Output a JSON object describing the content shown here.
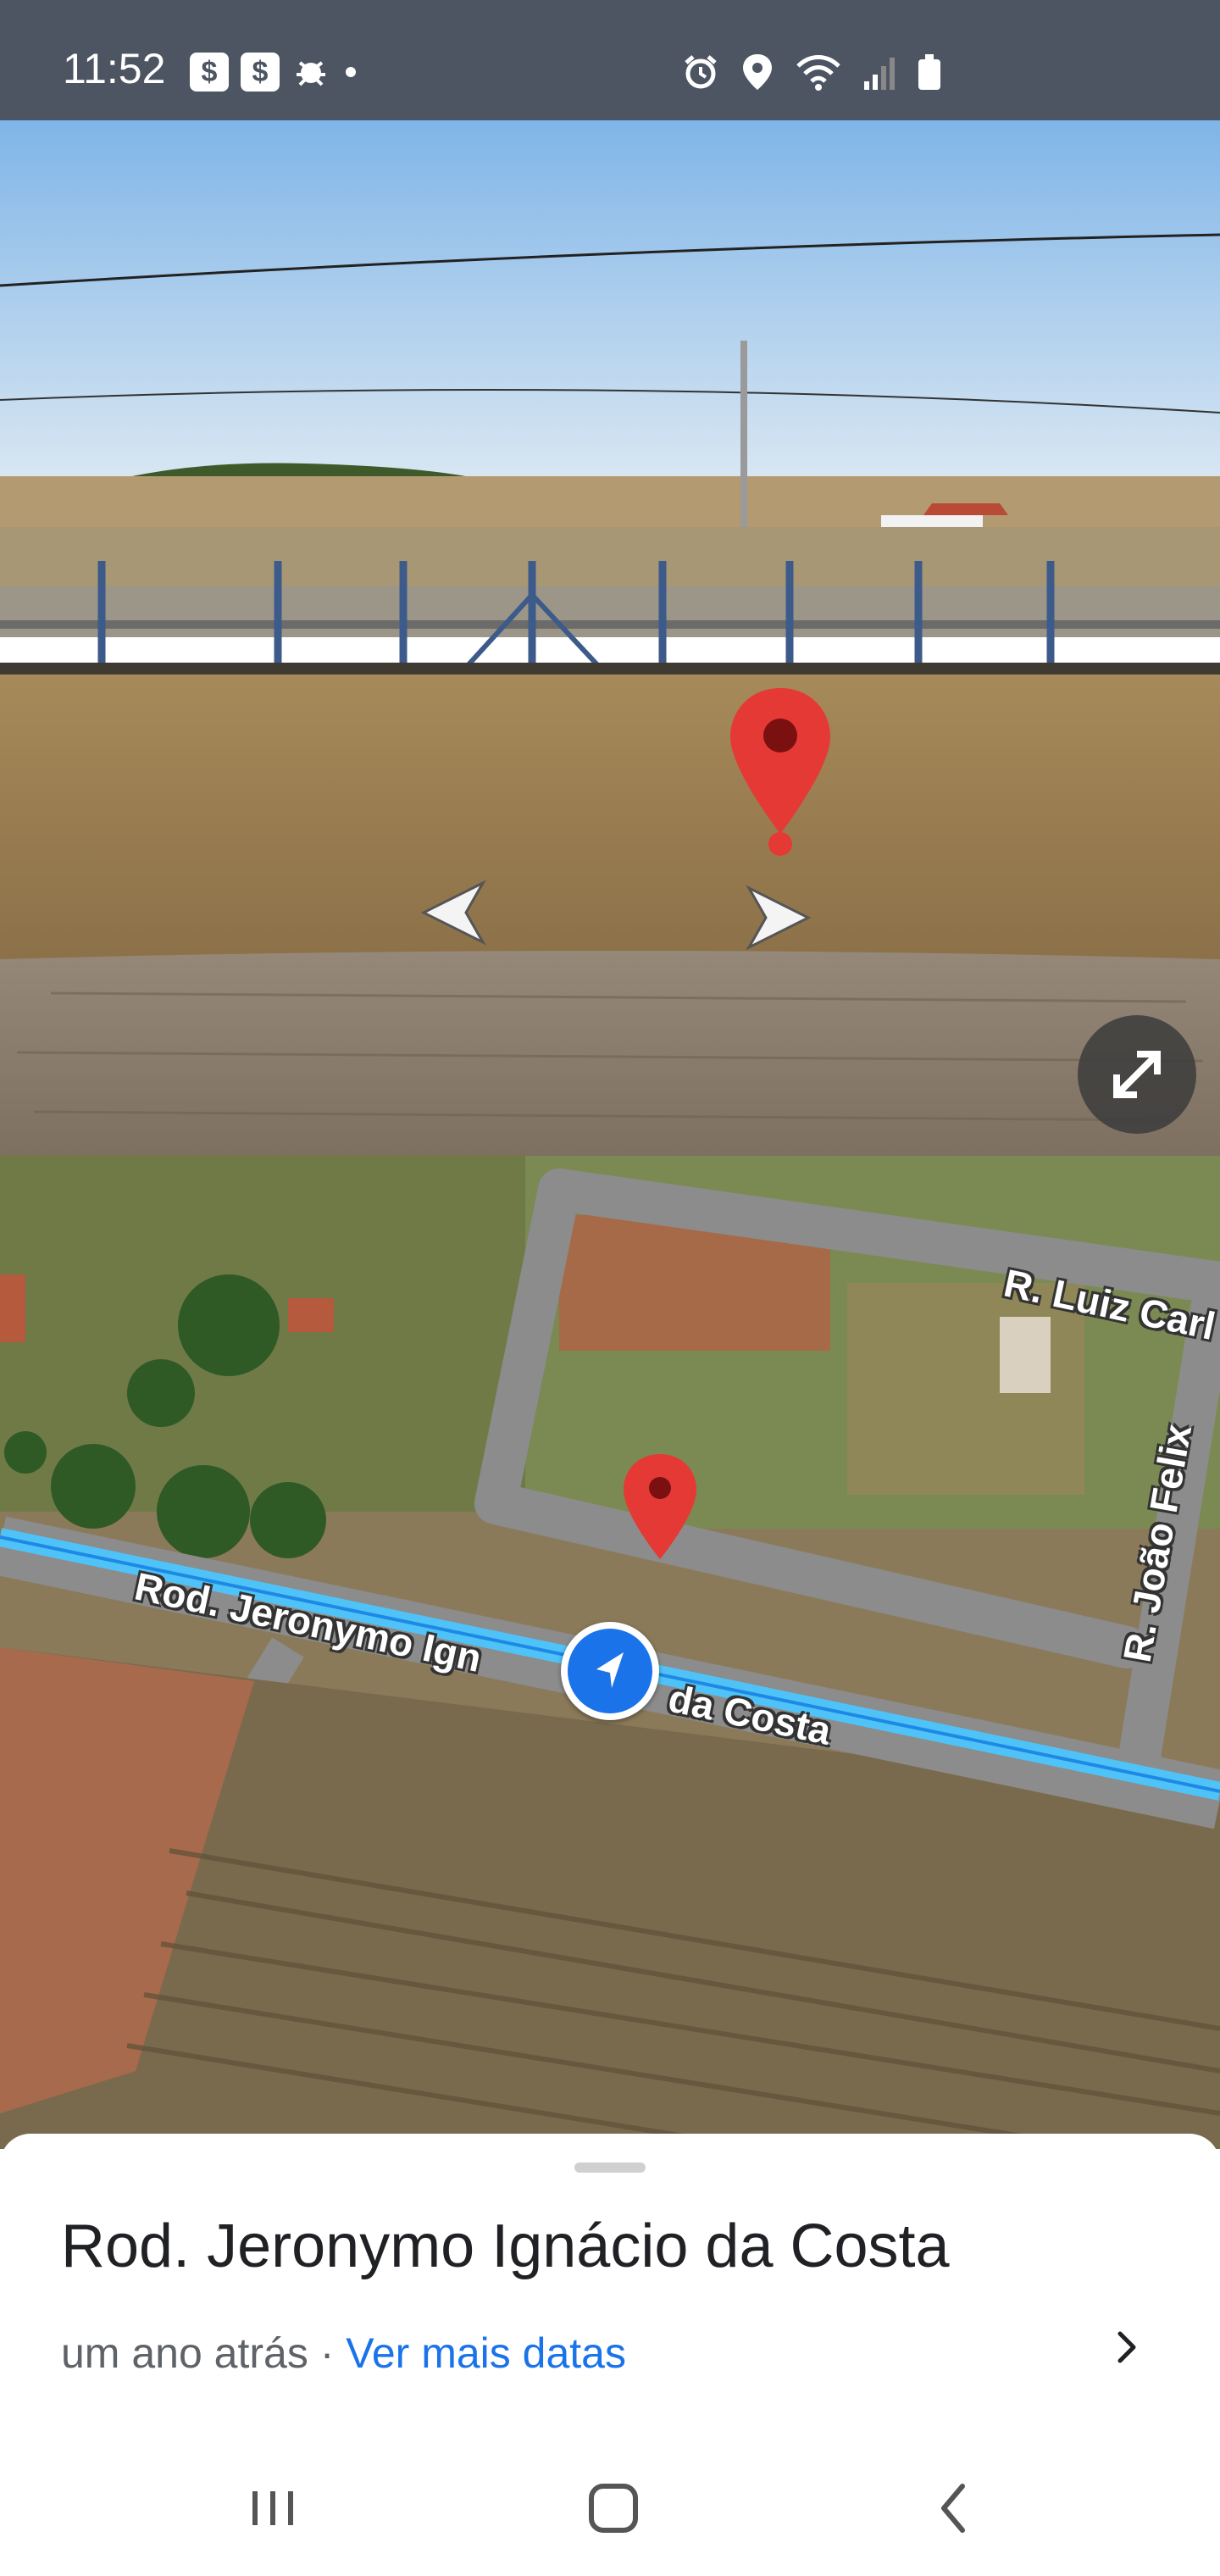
{
  "status_bar": {
    "time": "11:52",
    "left_icons": [
      "dollar-icon",
      "dollar-icon",
      "bug-icon",
      "dot-icon"
    ],
    "right_icons": [
      "alarm-icon",
      "location-icon",
      "wifi-icon",
      "signal-icon",
      "battery-icon"
    ]
  },
  "street_view": {
    "nav_left": "chevron-left-icon",
    "nav_right": "chevron-right-icon",
    "pin_color": "#e53935",
    "expand_icon": "expand-icon"
  },
  "map": {
    "road_main": "Rod. Jeronymo Ign",
    "road_main_rest": "da Costa",
    "road_top": "R. Luiz Carl",
    "road_right": "R. João Felix",
    "route_color": "#4fc3f7"
  },
  "sheet": {
    "title": "Rod. Jeronymo Ignácio da Costa",
    "date_text": "um ano atrás · ",
    "more_dates": "Ver mais datas"
  },
  "navbar": {
    "recents": "recents-icon",
    "home": "home-icon",
    "back": "back-icon"
  }
}
